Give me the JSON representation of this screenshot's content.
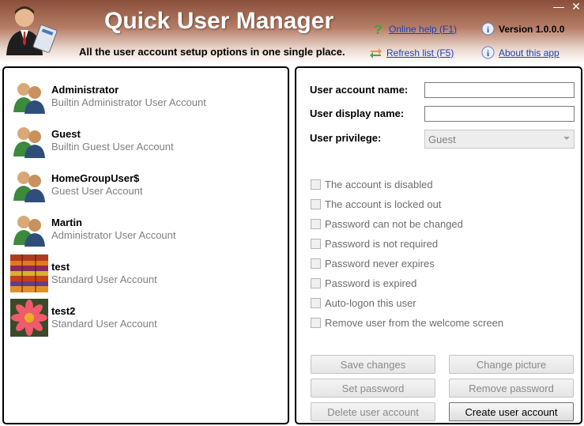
{
  "header": {
    "title": "Quick User Manager",
    "tagline": "All the user account setup options in one single place.",
    "help_link": "Online help (F1)",
    "refresh_link": "Refresh list (F5)",
    "version": "Version 1.0.0.0",
    "about_link": "About this app",
    "minimize": "—",
    "close": "✕"
  },
  "users": [
    {
      "name": "Administrator",
      "desc": "Builtin Administrator User Account",
      "pic": "users-icon"
    },
    {
      "name": "Guest",
      "desc": "Builtin Guest User Account",
      "pic": "users-icon"
    },
    {
      "name": "HomeGroupUser$",
      "desc": "Guest User Account",
      "pic": "users-icon"
    },
    {
      "name": "Martin",
      "desc": "Administrator User Account",
      "pic": "users-icon"
    },
    {
      "name": "test",
      "desc": "Standard User Account",
      "pic": "fabric-photo"
    },
    {
      "name": "test2",
      "desc": "Standard User Account",
      "pic": "flower-photo"
    }
  ],
  "form": {
    "account_name_label": "User account name:",
    "account_name_value": "",
    "display_name_label": "User display name:",
    "display_name_value": "",
    "privilege_label": "User privilege:",
    "privilege_value": "Guest"
  },
  "options": [
    "The account is disabled",
    "The account is locked out",
    "Password can not be changed",
    "Password is not required",
    "Password never expires",
    "Password is expired",
    "Auto-logon this user",
    "Remove user from the welcome screen"
  ],
  "buttons": {
    "save": "Save changes",
    "change_picture": "Change picture",
    "set_password": "Set password",
    "remove_password": "Remove password",
    "delete_user": "Delete user account",
    "create_user": "Create user account"
  },
  "colors": {
    "link": "#1a3fb8",
    "header_dark": "#8a4f3a",
    "disabled_text": "#8a8a8a"
  }
}
